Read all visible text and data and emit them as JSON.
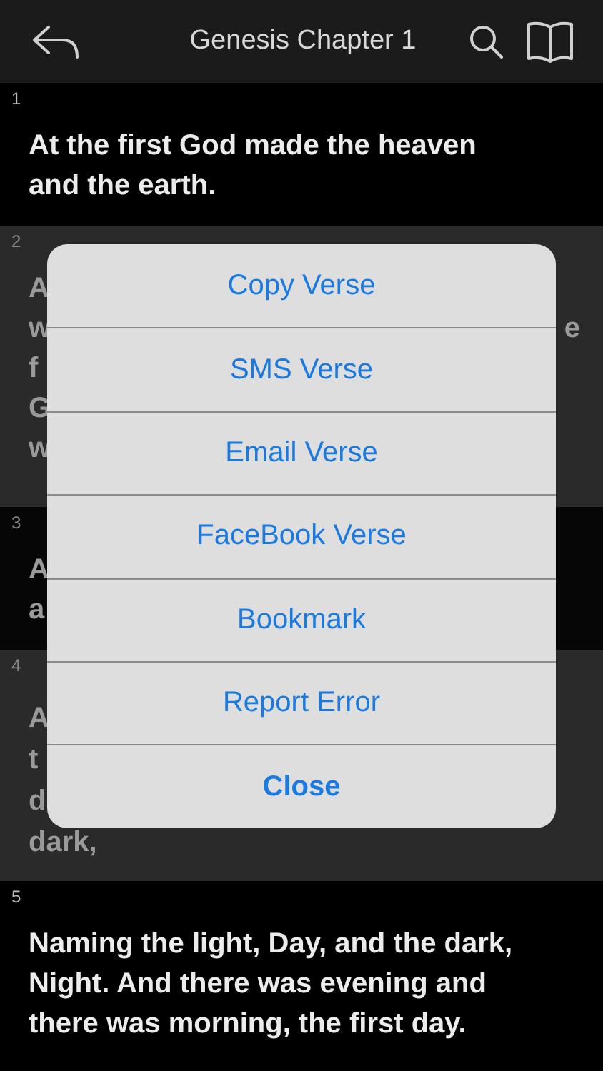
{
  "header": {
    "title": "Genesis Chapter 1"
  },
  "verses": [
    {
      "number": "1",
      "dimmed": false,
      "lines": [
        {
          "left": "At the first God made the heaven"
        },
        {
          "left": "and the earth."
        }
      ]
    },
    {
      "number": "2",
      "dimmed": true,
      "lines": [
        {
          "left": "A"
        },
        {
          "left": "w",
          "right": "e"
        },
        {
          "left": "f"
        },
        {
          "left": "G"
        },
        {
          "left": "w"
        }
      ]
    },
    {
      "number": "3",
      "dimmed": true,
      "lines": [
        {
          "left": "A"
        },
        {
          "left": "a"
        }
      ]
    },
    {
      "number": "4",
      "dimmed": true,
      "lines": [
        {
          "left": "A"
        },
        {
          "left": "t"
        },
        {
          "left": "d"
        },
        {
          "left": "dark,"
        }
      ]
    },
    {
      "number": "5",
      "dimmed": false,
      "lines": [
        {
          "left": "Naming the light, Day, and the dark,"
        },
        {
          "left": "Night. And there was evening and"
        },
        {
          "left": "there was morning, the first day."
        }
      ]
    }
  ],
  "menu": {
    "items": [
      {
        "label": "Copy Verse",
        "kind": "action"
      },
      {
        "label": "SMS Verse",
        "kind": "action"
      },
      {
        "label": "Email Verse",
        "kind": "action"
      },
      {
        "label": "FaceBook Verse",
        "kind": "action"
      },
      {
        "label": "Bookmark",
        "kind": "action"
      },
      {
        "label": "Report Error",
        "kind": "action"
      },
      {
        "label": "Close",
        "kind": "cancel"
      }
    ]
  }
}
